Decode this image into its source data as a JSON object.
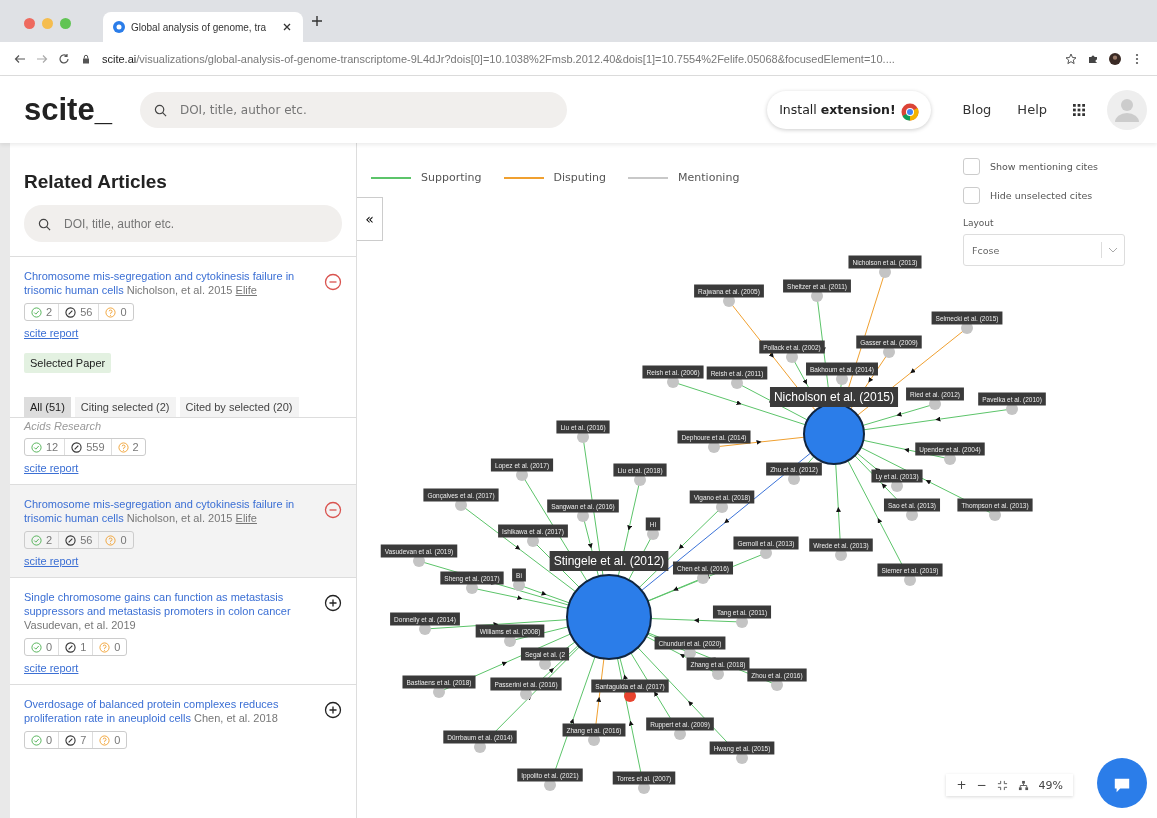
{
  "browser": {
    "tab_title": "Global analysis of genome, tra",
    "url_host": "scite.ai",
    "url_path": "/visualizations/global-analysis-of-genome-transcriptome-9L4dJr?dois[0]=10.1038%2Fmsb.2012.40&dois[1]=10.7554%2Felife.05068&focusedElement=10...."
  },
  "header": {
    "logo": "scite_",
    "search_placeholder": "DOI, title, author etc.",
    "install_button": "Install **extension!**",
    "links": [
      "Blog",
      "Help"
    ]
  },
  "sidebar": {
    "title": "Related Articles",
    "search_placeholder": "DOI, title, author etc.",
    "selected_article": {
      "title": "Chromosome mis-segregation and cytokinesis failure in trisomic human cells",
      "authors": "Nicholson, et al. 2015",
      "journal": "Elife",
      "selected": true,
      "supporting": "2",
      "mentioning": "56",
      "disputing": "0",
      "report": "scite report",
      "badge": "Selected Paper"
    },
    "tabs": [
      {
        "label": "All (51)",
        "selected": true
      },
      {
        "label": "Citing selected (2)",
        "selected": false
      },
      {
        "label": "Cited by selected (20)",
        "selected": false
      }
    ],
    "articles": [
      {
        "kind": "partial",
        "journal": "Acids Research",
        "supporting": "12",
        "mentioning": "559",
        "disputing": "2",
        "report": "scite report",
        "highlighted": false
      },
      {
        "kind": "full",
        "title": "Chromosome mis-segregation and cytokinesis failure in trisomic human cells",
        "authors": "Nicholson, et al. 2015",
        "journal": "Elife",
        "selected": true,
        "supporting": "2",
        "mentioning": "56",
        "disputing": "0",
        "report": "scite report",
        "highlighted": true
      },
      {
        "kind": "full",
        "title": "Single chromosome gains can function as metastasis suppressors and metastasis promoters in colon cancer",
        "authors": "Vasudevan, et al. 2019",
        "selected": false,
        "supporting": "0",
        "mentioning": "1",
        "disputing": "0",
        "report": "scite report",
        "highlighted": false
      },
      {
        "kind": "full",
        "title": "Overdosage of balanced protein complexes reduces proliferation rate in aneuploid cells",
        "authors": "Chen, et al. 2018",
        "selected": false,
        "supporting": "0",
        "mentioning": "7",
        "disputing": "0",
        "highlighted": false
      }
    ]
  },
  "graph": {
    "collapse_button": "«",
    "legend": [
      {
        "label": "Supporting",
        "kind": "supporting"
      },
      {
        "label": "Disputing",
        "kind": "disputing"
      },
      {
        "label": "Mentioning",
        "kind": "mentioning"
      }
    ],
    "options": [
      {
        "label": "Show mentioning cites",
        "checked": false
      },
      {
        "label": "Hide unselected cites",
        "checked": false
      }
    ],
    "layout": {
      "label": "Layout",
      "value": "Fcose"
    },
    "hub_link": {
      "kind": "highlighted"
    },
    "hubs": [
      {
        "label": "Nicholson et al. (2015)",
        "citations": [
          {
            "label": "Nicholson et al. (2013)",
            "kind": "disputing",
            "highlighted": false
          },
          {
            "label": "Sheltzer et al. (2011)",
            "kind": "supporting",
            "highlighted": false
          },
          {
            "label": "Rajwana et al. (2005)",
            "kind": "disputing",
            "highlighted": false
          },
          {
            "label": "Selmecki et al. (2015)",
            "kind": "disputing",
            "highlighted": false
          },
          {
            "label": "Gasser et al. (2009)",
            "kind": "disputing",
            "highlighted": false
          },
          {
            "label": "Pollack et al. (2002)",
            "kind": "supporting",
            "highlighted": false
          },
          {
            "label": "Bakhoum et al. (2014)",
            "kind": "supporting",
            "highlighted": false
          },
          {
            "label": "Reish et al. (2006)",
            "kind": "supporting",
            "highlighted": false
          },
          {
            "label": "Reish et al. (2011)",
            "kind": "supporting",
            "highlighted": false
          },
          {
            "label": "Ried et al. (2012)",
            "kind": "supporting",
            "highlighted": false
          },
          {
            "label": "Pavelka et al. (2010)",
            "kind": "supporting",
            "highlighted": false
          },
          {
            "label": "Dephoure et al. (2014)",
            "kind": "disputing",
            "highlighted": false
          },
          {
            "label": "Upender et al. (2004)",
            "kind": "supporting",
            "highlighted": false
          },
          {
            "label": "Ly et al. (2013)",
            "kind": "supporting",
            "highlighted": false
          },
          {
            "label": "Zhu et al. (2012)",
            "kind": "supporting",
            "highlighted": false
          },
          {
            "label": "Sao et al. (2013)",
            "kind": "supporting",
            "highlighted": false
          },
          {
            "label": "Thompson et al. (2013)",
            "kind": "supporting",
            "highlighted": false
          },
          {
            "label": "Wrede et al. (2013)",
            "kind": "supporting",
            "highlighted": false
          },
          {
            "label": "Siemer et al. (2019)",
            "kind": "supporting",
            "highlighted": false
          }
        ]
      },
      {
        "label": "Stingele et al. (2012)",
        "citations": [
          {
            "label": "Liu et al. (2016)",
            "kind": "supporting",
            "highlighted": false
          },
          {
            "label": "Lopez et al. (2017)",
            "kind": "supporting",
            "highlighted": false
          },
          {
            "label": "Liu et al. (2018)",
            "kind": "supporting",
            "highlighted": false
          },
          {
            "label": "Gonçalves et al. (2017)",
            "kind": "supporting",
            "highlighted": false
          },
          {
            "label": "Vigano et al. (2018)",
            "kind": "supporting",
            "highlighted": false
          },
          {
            "label": "Sangwan et al. (2016)",
            "kind": "supporting",
            "highlighted": false
          },
          {
            "label": "HI",
            "kind": "supporting",
            "highlighted": false
          },
          {
            "label": "Ishikawa et al. (2017)",
            "kind": "supporting",
            "highlighted": false
          },
          {
            "label": "Gemoll et al. (2013)",
            "kind": "supporting",
            "highlighted": false
          },
          {
            "label": "Vasudevan et al. (2019)",
            "kind": "supporting",
            "highlighted": false
          },
          {
            "label": "Chen et al. (2016)",
            "kind": "supporting",
            "highlighted": false
          },
          {
            "label": "Bi",
            "kind": "supporting",
            "highlighted": false
          },
          {
            "label": "Sheng et al. (2017)",
            "kind": "supporting",
            "highlighted": false
          },
          {
            "label": "Tang et al. (2011)",
            "kind": "supporting",
            "highlighted": false
          },
          {
            "label": "Donnelly et al. (2014)",
            "kind": "supporting",
            "highlighted": false
          },
          {
            "label": "Williams et al. (2008)",
            "kind": "supporting",
            "highlighted": false
          },
          {
            "label": "Chunduri et al. (2020)",
            "kind": "supporting",
            "highlighted": false
          },
          {
            "label": "Segal et al. (2",
            "kind": "supporting",
            "highlighted": false
          },
          {
            "label": "Zhang et al. (2018)",
            "kind": "supporting",
            "highlighted": false
          },
          {
            "label": "Zhou et al. (2016)",
            "kind": "supporting",
            "highlighted": false
          },
          {
            "label": "Bastiaens et al. (2018)",
            "kind": "supporting",
            "highlighted": false
          },
          {
            "label": "Passerini et al. (2016)",
            "kind": "supporting",
            "highlighted": false
          },
          {
            "label": "Santaguida et al. (2017)",
            "kind": "supporting",
            "highlighted": true
          },
          {
            "label": "Ruppert et al. (2009)",
            "kind": "supporting",
            "highlighted": false
          },
          {
            "label": "Zhang et al. (2016)",
            "kind": "disputing",
            "highlighted": false
          },
          {
            "label": "Dürrbaum et al. (2014)",
            "kind": "supporting",
            "highlighted": false
          },
          {
            "label": "Hwang et al. (2015)",
            "kind": "supporting",
            "highlighted": false
          },
          {
            "label": "Ippolito et al. (2021)",
            "kind": "supporting",
            "highlighted": false
          },
          {
            "label": "Torres et al. (2007)",
            "kind": "supporting",
            "highlighted": false
          }
        ]
      }
    ],
    "zoom_controls": {
      "zoom_in": "+",
      "zoom_out": "−",
      "zoom_level": "49%"
    }
  }
}
